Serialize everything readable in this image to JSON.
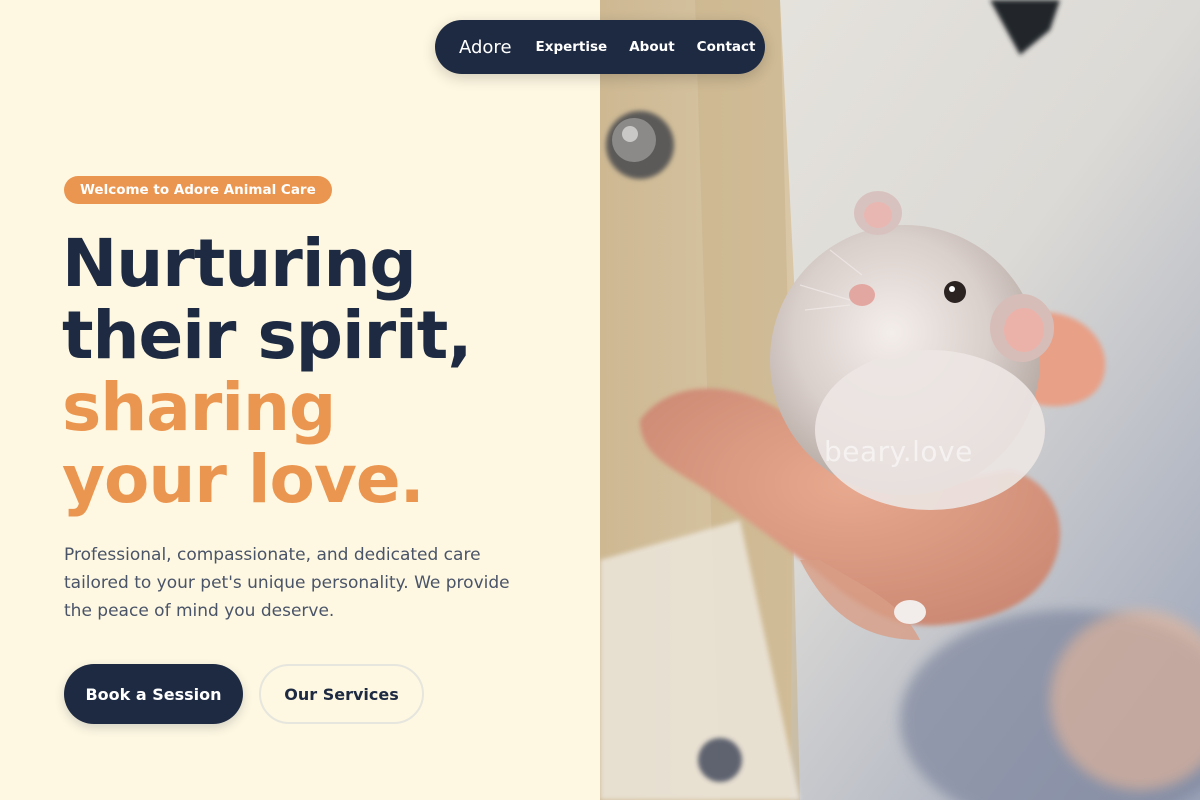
{
  "nav": {
    "brand": "Adore",
    "links": [
      "Expertise",
      "About",
      "Contact"
    ]
  },
  "hero": {
    "badge": "Welcome to Adore Animal Care",
    "headline_dark": [
      "Nurturing",
      "their spirit,"
    ],
    "headline_accent": [
      "sharing",
      "your love."
    ],
    "description": "Professional, compassionate, and dedicated care tailored to your pet's unique personality. We provide the peace of mind you deserve.",
    "primary_button": "Book a Session",
    "secondary_button": "Our Services"
  },
  "photo": {
    "subject": "hamster-in-hand-photo",
    "watermark": "beary.love"
  },
  "colors": {
    "background": "#fef8e2",
    "navy": "#1e2a42",
    "accent": "#eb9650",
    "body_text": "#4a5468"
  }
}
